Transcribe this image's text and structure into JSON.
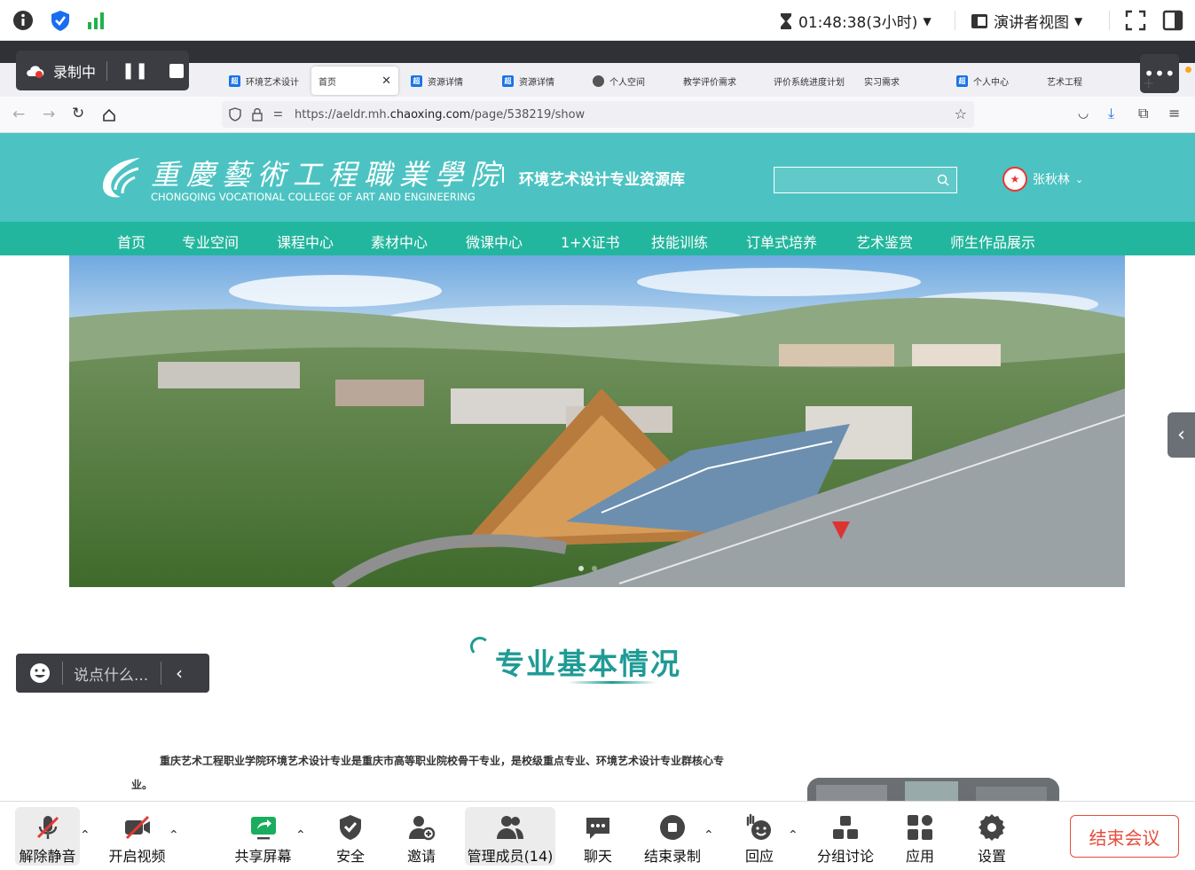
{
  "meeting": {
    "timer": "01:48:38(3小时)",
    "presenter_view": "演讲者视图",
    "recording_label": "录制中",
    "chat_placeholder": "说点什么..."
  },
  "browser": {
    "tabs": [
      {
        "label": "环境艺术设计",
        "icon": "chaoxing-icon"
      },
      {
        "label": "首页",
        "active": true
      },
      {
        "label": "资源详情",
        "icon": "chaoxing-icon"
      },
      {
        "label": "资源详情",
        "icon": "chaoxing-icon"
      },
      {
        "label": "个人空间",
        "icon": "globe-icon"
      },
      {
        "label": "教学评价需求"
      },
      {
        "label": "评价系统进度计划"
      },
      {
        "label": "实习需求"
      },
      {
        "label": "个人中心",
        "icon": "chaoxing-icon"
      },
      {
        "label": "艺术工程"
      }
    ],
    "url_prefix": "https://aeldr.mh.",
    "url_domain": "chaoxing.com",
    "url_path": "/page/538219/show"
  },
  "site": {
    "logo_cn": "重慶藝術工程職業學院",
    "logo_en": "CHONGQING VOCATIONAL COLLEGE OF ART AND ENGINEERING",
    "subtitle": "环境艺术设计专业资源库",
    "user_name": "张秋林",
    "menu": [
      "首页",
      "专业空间",
      "课程中心",
      "素材中心",
      "微课中心",
      "1+X证书",
      "技能训练",
      "订单式培养",
      "艺术鉴赏",
      "师生作品展示"
    ],
    "section_title": "专业基本情况",
    "intro_line1": "重庆艺术工程职业学院环境艺术设计专业是重庆市高等职业院校骨干专业，是校级重点专业、环境艺术设计专业群核心专",
    "intro_line2": "业。"
  },
  "toolbar": {
    "items": [
      {
        "label": "解除静音",
        "icon": "mic-muted-icon"
      },
      {
        "label": "开启视频",
        "icon": "video-off-icon"
      },
      {
        "label": "共享屏幕",
        "icon": "share-screen-icon"
      },
      {
        "label": "安全",
        "icon": "shield-icon"
      },
      {
        "label": "邀请",
        "icon": "invite-icon"
      },
      {
        "label": "管理成员(14)",
        "icon": "members-icon"
      },
      {
        "label": "聊天",
        "icon": "chat-icon"
      },
      {
        "label": "结束录制",
        "icon": "stop-record-icon"
      },
      {
        "label": "回应",
        "icon": "reaction-icon"
      },
      {
        "label": "分组讨论",
        "icon": "breakout-icon"
      },
      {
        "label": "应用",
        "icon": "apps-icon"
      },
      {
        "label": "设置",
        "icon": "gear-icon"
      }
    ],
    "end_meeting": "结束会议"
  },
  "colors": {
    "header_teal": "#4cc3c2",
    "menu_green": "#23b69e",
    "title_teal": "#1f9b96",
    "end_red": "#e74c3c"
  }
}
